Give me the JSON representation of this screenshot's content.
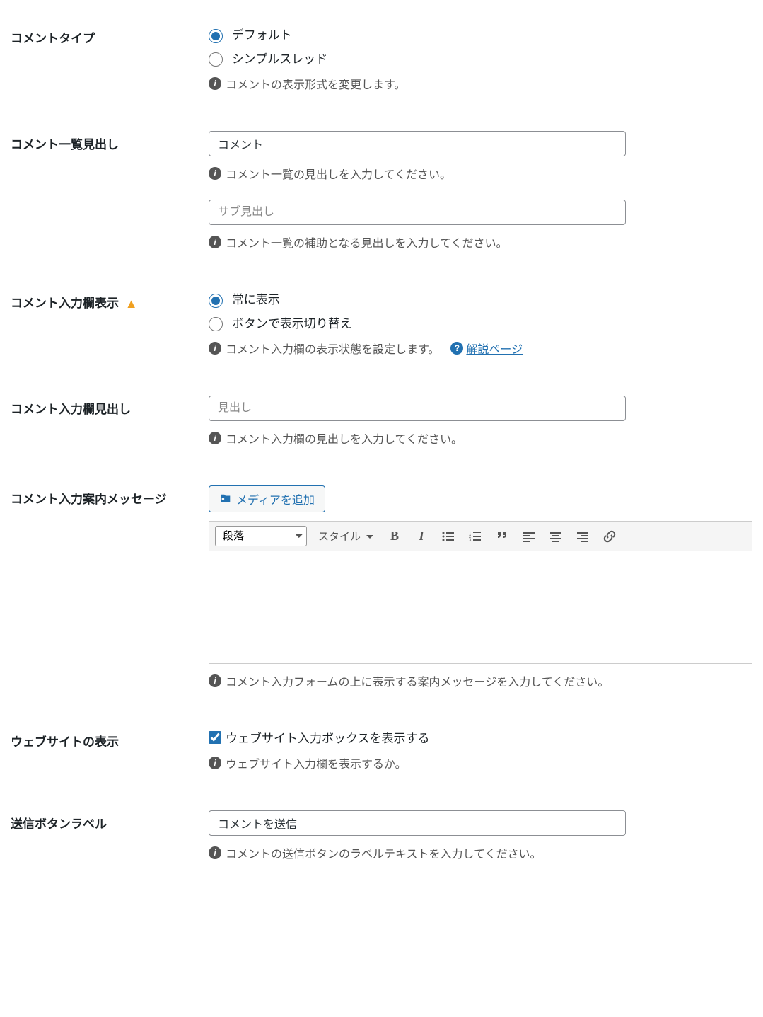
{
  "labels": {
    "comment_type": "コメントタイプ",
    "comment_list_heading": "コメント一覧見出し",
    "comment_input_display": "コメント入力欄表示",
    "comment_input_heading": "コメント入力欄見出し",
    "comment_input_guide": "コメント入力案内メッセージ",
    "website_display": "ウェブサイトの表示",
    "submit_button_label": "送信ボタンラベル"
  },
  "comment_type": {
    "options": {
      "default": "デフォルト",
      "simple_thread": "シンプルスレッド"
    },
    "desc": "コメントの表示形式を変更します。"
  },
  "comment_list": {
    "value": "コメント",
    "desc1": "コメント一覧の見出しを入力してください。",
    "sub_placeholder": "サブ見出し",
    "desc2": "コメント一覧の補助となる見出しを入力してください。"
  },
  "comment_input_display": {
    "options": {
      "always": "常に表示",
      "toggle_button": "ボタンで表示切り替え"
    },
    "desc": "コメント入力欄の表示状態を設定します。",
    "help_link": "解説ページ"
  },
  "comment_input_heading": {
    "placeholder": "見出し",
    "desc": "コメント入力欄の見出しを入力してください。"
  },
  "comment_guide": {
    "media_button": "メディアを追加",
    "paragraph_select": "段落",
    "style_dropdown": "スタイル",
    "desc": "コメント入力フォームの上に表示する案内メッセージを入力してください。"
  },
  "website": {
    "checkbox_label": "ウェブサイト入力ボックスを表示する",
    "desc": "ウェブサイト入力欄を表示するか。"
  },
  "submit": {
    "value": "コメントを送信",
    "desc": "コメントの送信ボタンのラベルテキストを入力してください。"
  }
}
